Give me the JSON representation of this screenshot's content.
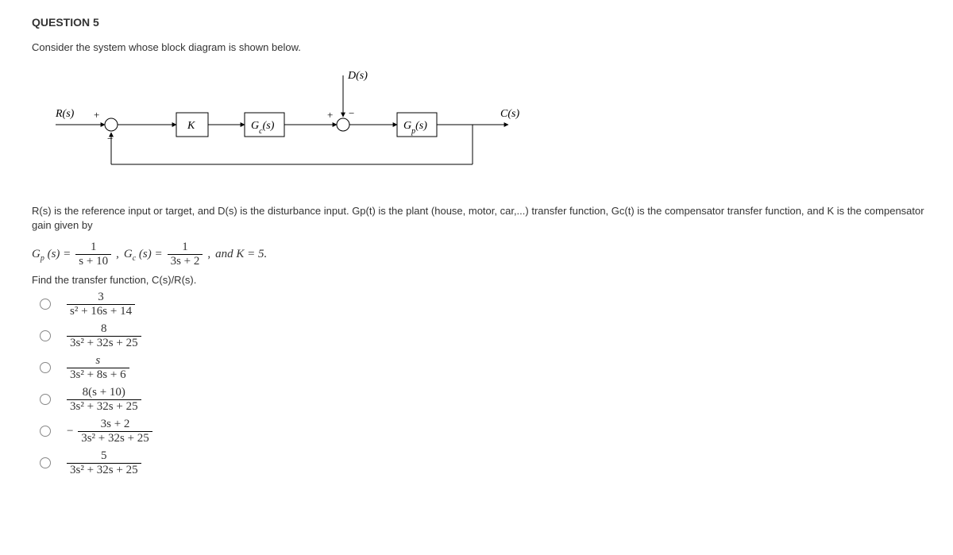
{
  "heading": "QUESTION 5",
  "prompt": "Consider the system whose block diagram is shown below.",
  "diagram": {
    "R": "R(s)",
    "plus1": "+",
    "minus1": "−",
    "K": "K",
    "Gc": "G_c(s)",
    "plus2": "+",
    "minus2": "−",
    "D": "D(s)",
    "Gp": "G_p(s)",
    "C": "C(s)"
  },
  "description": "R(s) is the reference input or target, and D(s) is the disturbance input.  Gp(t) is the plant (house, motor, car,...) transfer function, Gc(t) is the compensator transfer function, and K is the compensator gain given by",
  "equations": {
    "Gp": {
      "left": "G",
      "sub": "p",
      "mid": "(s) =",
      "num": "1",
      "den": "s + 10"
    },
    "comma1": ",  ",
    "Gc": {
      "left": "G",
      "sub": "c",
      "mid": "(s) =",
      "num": "1",
      "den": "3s + 2"
    },
    "comma2": ",  ",
    "andK": "and K = 5.",
    "period": ""
  },
  "instruction": "Find the transfer function, C(s)/R(s).",
  "options": [
    {
      "num": "3",
      "den": "s² + 16s + 14",
      "neg": false
    },
    {
      "num": "8",
      "den": "3s² + 32s + 25",
      "neg": false
    },
    {
      "num": "s",
      "den": "3s² + 8s + 6",
      "neg": false
    },
    {
      "num": "8(s + 10)",
      "den": "3s² + 32s + 25",
      "neg": false
    },
    {
      "num": "3s + 2",
      "den": "3s² + 32s + 25",
      "neg": true
    },
    {
      "num": "5",
      "den": "3s² + 32s + 25",
      "neg": false
    }
  ]
}
